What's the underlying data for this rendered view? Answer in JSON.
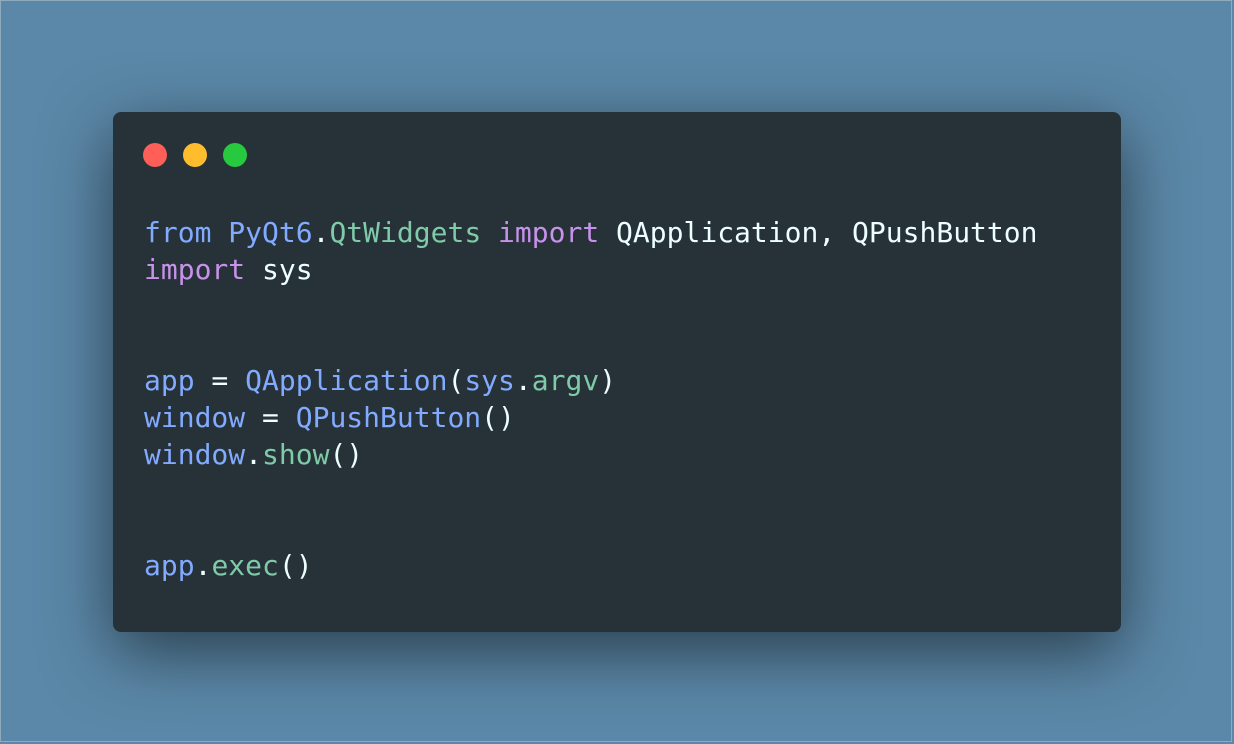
{
  "window": {
    "controls": [
      "close",
      "minimize",
      "maximize"
    ],
    "colors": {
      "close": "#ff5f56",
      "minimize": "#ffbd2e",
      "maximize": "#27c93f",
      "background": "#263238"
    }
  },
  "code": {
    "language": "python",
    "lines": [
      [
        [
          "kw2",
          "from"
        ],
        [
          "plain",
          " "
        ],
        [
          "id",
          "PyQt6"
        ],
        [
          "plain",
          "."
        ],
        [
          "attr",
          "QtWidgets"
        ],
        [
          "plain",
          " "
        ],
        [
          "kw",
          "import"
        ],
        [
          "plain",
          " QApplication, QPushButton"
        ]
      ],
      [
        [
          "kw",
          "import"
        ],
        [
          "plain",
          " sys"
        ]
      ],
      [],
      [],
      [
        [
          "id",
          "app"
        ],
        [
          "plain",
          " = "
        ],
        [
          "id",
          "QApplication"
        ],
        [
          "plain",
          "("
        ],
        [
          "id",
          "sys"
        ],
        [
          "plain",
          "."
        ],
        [
          "attr",
          "argv"
        ],
        [
          "plain",
          ")"
        ]
      ],
      [
        [
          "id",
          "window"
        ],
        [
          "plain",
          " = "
        ],
        [
          "id",
          "QPushButton"
        ],
        [
          "plain",
          "()"
        ]
      ],
      [
        [
          "id",
          "window"
        ],
        [
          "plain",
          "."
        ],
        [
          "attr",
          "show"
        ],
        [
          "plain",
          "()"
        ]
      ],
      [],
      [],
      [
        [
          "id",
          "app"
        ],
        [
          "plain",
          "."
        ],
        [
          "attr",
          "exec"
        ],
        [
          "plain",
          "()"
        ]
      ]
    ]
  }
}
